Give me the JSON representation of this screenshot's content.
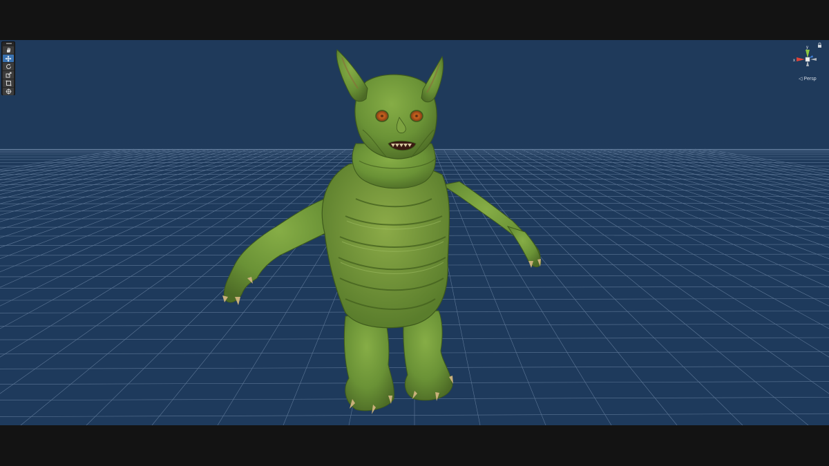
{
  "window": {
    "letterbox_color": "#131313",
    "scene_background": "#1f3a5b",
    "grid_line_color": "#5e7898"
  },
  "toolbar": {
    "tools": [
      {
        "name": "hand-tool",
        "icon": "hand-icon",
        "active": false
      },
      {
        "name": "move-tool",
        "icon": "move-arrows-icon",
        "active": true
      },
      {
        "name": "rotate-tool",
        "icon": "rotate-icon",
        "active": false
      },
      {
        "name": "scale-tool",
        "icon": "scale-icon",
        "active": false
      },
      {
        "name": "rect-tool",
        "icon": "rect-transform-icon",
        "active": false
      },
      {
        "name": "transform-tool",
        "icon": "transform-icon",
        "active": false
      }
    ],
    "active_color": "#3a72b0"
  },
  "gizmo": {
    "projection_label": "◁ Persp",
    "axes": {
      "x": "x",
      "y": "y"
    },
    "colors": {
      "x": "#d9433a",
      "y": "#8dc63f",
      "z": "#3d7fd9"
    },
    "lock_icon": "lock-icon"
  },
  "scene": {
    "object": "green-creature-model",
    "skin_color": "#6f9a3a",
    "eye_color": "#c8621f"
  }
}
